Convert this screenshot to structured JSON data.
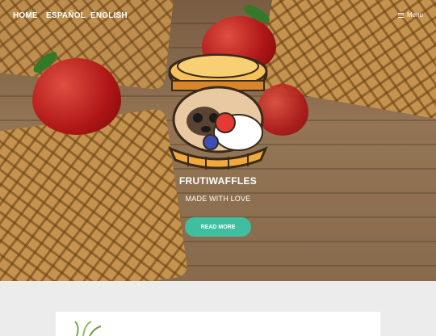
{
  "nav": {
    "links": [
      "HOME",
      "ESPAÑOL",
      "ENGLISH"
    ],
    "menu_label": "Menu"
  },
  "hero": {
    "title": "FRUTIWAFFLES",
    "subtitle": "MADE WITH LOVE",
    "button_label": "READ MORE"
  },
  "colors": {
    "accent": "#3fbfa0",
    "page_background": "#ececec"
  },
  "icons": {
    "menu": "hamburger-icon",
    "logo": "pug-waffle-logo"
  }
}
